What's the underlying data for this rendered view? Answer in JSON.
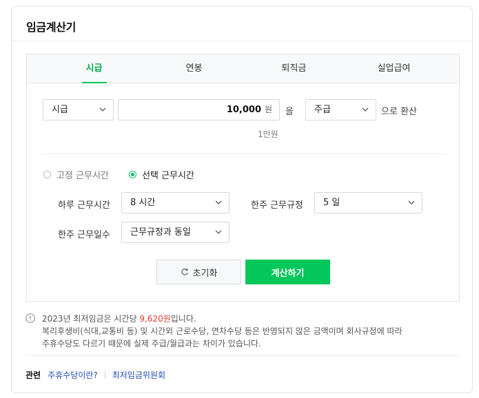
{
  "title": "임금계산기",
  "tabs": [
    {
      "label": "시급",
      "active": true
    },
    {
      "label": "연봉",
      "active": false
    },
    {
      "label": "퇴직금",
      "active": false
    },
    {
      "label": "실업급여",
      "active": false
    }
  ],
  "converter": {
    "from_unit": "시급",
    "amount": "10,000",
    "amount_unit": "원",
    "particle": "을",
    "to_unit": "주급",
    "suffix": "으로 환산",
    "amount_hint": "1만원"
  },
  "work_mode": {
    "options": [
      {
        "label": "고정 근무시간",
        "selected": false
      },
      {
        "label": "선택 근무시간",
        "selected": true
      }
    ]
  },
  "fields": {
    "daily_hours_label": "하루 근무시간",
    "daily_hours_value": "8 시간",
    "weekly_rule_label": "한주 근무규정",
    "weekly_rule_value": "5 일",
    "weekly_days_label": "한주 근무일수",
    "weekly_days_value": "근무규정과 동일"
  },
  "buttons": {
    "reset": "초기화",
    "calculate": "계산하기"
  },
  "notice": {
    "line1_pre": "2023년 최저임금은 시간당 ",
    "line1_wage": "9,620원",
    "line1_post": "입니다.",
    "line2": "복리후생비(식대,교통비 등) 및 시간외 근로수당, 연차수당 등은 반영되지 않은 금액이며 회사규정에 따라",
    "line3": "주휴수당도 다르기 때문에 실제 주급/월급과는 차이가 있습니다."
  },
  "related": {
    "label": "관련",
    "links": [
      "주휴수당이란?",
      "최저임금위원회"
    ]
  },
  "colors": {
    "accent": "#03c75a",
    "highlight": "#e0382c",
    "link": "#1a4bb7"
  },
  "icons": {
    "dropdown": "chevron-down-icon",
    "reset": "refresh-icon",
    "notice": "info-icon"
  }
}
